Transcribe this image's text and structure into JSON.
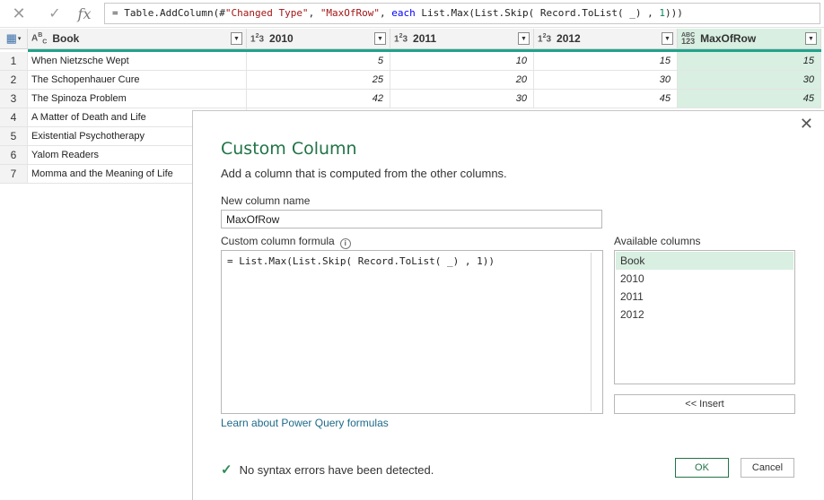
{
  "formula_bar": {
    "cancel_icon": "close-icon",
    "commit_icon": "check-icon",
    "fx_label": "fx",
    "formula_parts": {
      "p1": "= Table.AddColumn(#",
      "p2": "\"Changed Type\"",
      "p3": ", ",
      "p4": "\"MaxOfRow\"",
      "p5": ", ",
      "p6": "each",
      "p7": " List.Max(List.Skip( Record.ToList( _)  , ",
      "p8": "1",
      "p9": ")))"
    }
  },
  "table": {
    "columns": [
      {
        "name": "Book",
        "type_label": "ABC"
      },
      {
        "name": "2010",
        "type_label": "1²3"
      },
      {
        "name": "2011",
        "type_label": "1²3"
      },
      {
        "name": "2012",
        "type_label": "1²3"
      },
      {
        "name": "MaxOfRow",
        "type_label": "ABC 123"
      }
    ],
    "rows": [
      {
        "idx": "1",
        "book": "When Nietzsche Wept",
        "y2010": "5",
        "y2011": "10",
        "y2012": "15",
        "max": "15"
      },
      {
        "idx": "2",
        "book": "The Schopenhauer Cure",
        "y2010": "25",
        "y2011": "20",
        "y2012": "30",
        "max": "30"
      },
      {
        "idx": "3",
        "book": "The Spinoza Problem",
        "y2010": "42",
        "y2011": "30",
        "y2012": "45",
        "max": "45"
      },
      {
        "idx": "4",
        "book": "A Matter of Death and Life"
      },
      {
        "idx": "5",
        "book": "Existential Psychotherapy"
      },
      {
        "idx": "6",
        "book": "Yalom Readers"
      },
      {
        "idx": "7",
        "book": "Momma and the Meaning of Life"
      }
    ]
  },
  "dialog": {
    "title": "Custom Column",
    "subtitle": "Add a column that is computed from the other columns.",
    "new_column_label": "New column name",
    "new_column_value": "MaxOfRow",
    "formula_label": "Custom column formula",
    "formula_value": "= List.Max(List.Skip( Record.ToList( _)  , 1))",
    "available_label": "Available columns",
    "available_columns": [
      "Book",
      "2010",
      "2011",
      "2012"
    ],
    "insert_label": "<< Insert",
    "learn_link": "Learn about Power Query formulas",
    "status": "No syntax errors have been detected.",
    "ok_label": "OK",
    "cancel_label": "Cancel"
  },
  "colors": {
    "accent": "#217346",
    "selection": "#d8efe2",
    "header_line": "#1fa38c"
  }
}
